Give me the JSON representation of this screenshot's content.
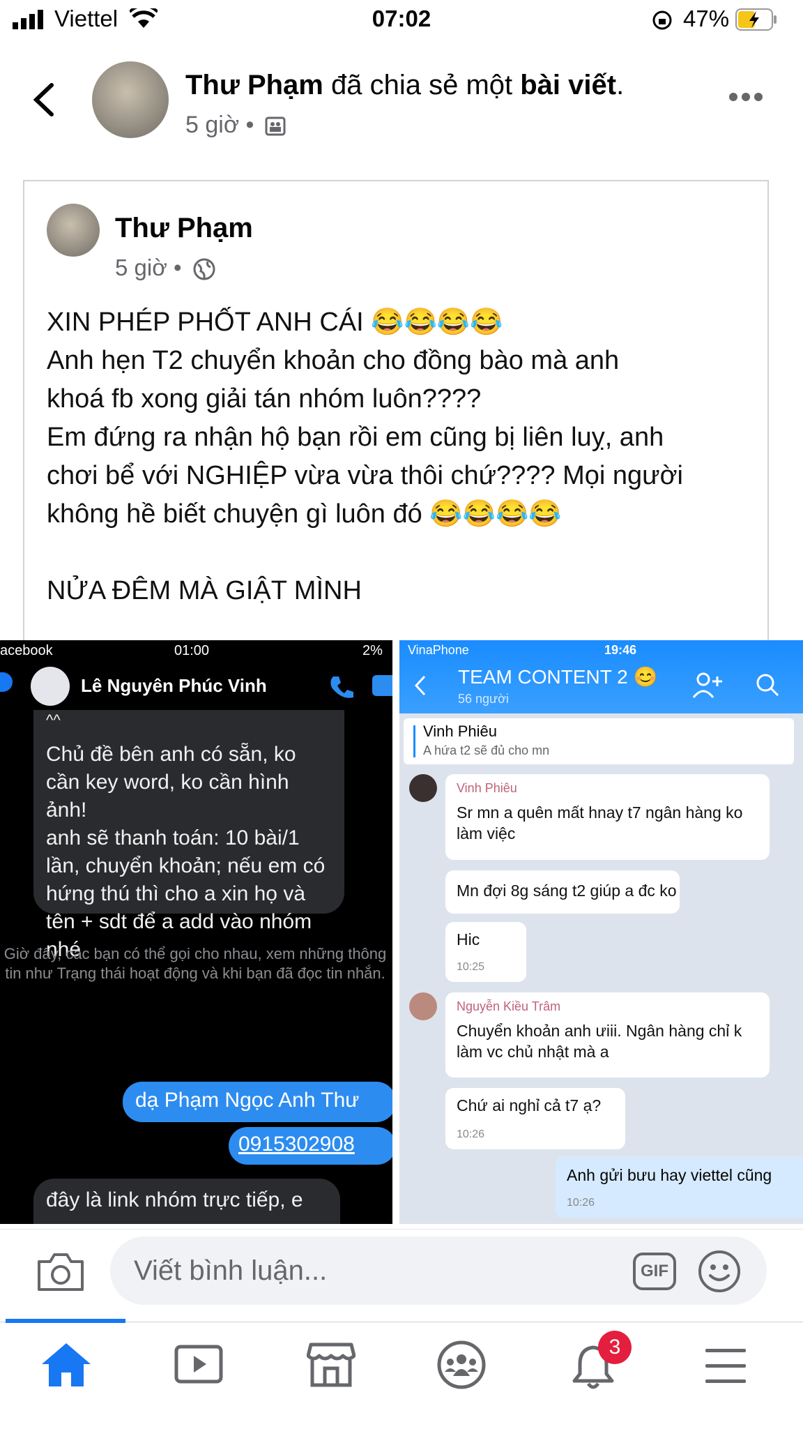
{
  "status_bar": {
    "carrier": "Viettel",
    "time": "07:02",
    "battery": "47%"
  },
  "header": {
    "name": "Thư Phạm",
    "action_mid": " đã chia sẻ một ",
    "action_end": "bài viết",
    "action_dot": ".",
    "meta": "5 giờ •"
  },
  "post": {
    "author": "Thư Phạm",
    "meta": "5 giờ •",
    "text": "XIN PHÉP PHỐT ANH CÁI 😂😂😂😂\nAnh hẹn T2 chuyển khoản cho đồng bào mà anh\nkhoá fb xong giải tán nhóm luôn????\nEm đứng ra nhận hộ bạn rồi em cũng bị liên luỵ, anh\nchơi bể với NGHIỆP vừa vừa thôi chứ???? Mọi người\nkhông hề biết chuyện gì luôn đó 😂😂😂😂\n\nNỬA ĐÊM MÀ GIẬT MÌNH"
  },
  "left_shot": {
    "status_left": "acebook",
    "status_time": "01:00",
    "status_right": "2%",
    "contact_name": "Lê Nguyên Phúc Vinh",
    "msg_top": "^^",
    "msg_main": "Chủ đề bên anh có sẵn, ko cần key word, ko cần hình ảnh!\nanh sẽ thanh toán: 10 bài/1 lần, chuyển khoản; nếu em có hứng thú thì cho a xin họ và tên + sdt để a add vào nhóm nhé",
    "system_note": "Giờ đây, các bạn có thể gọi cho nhau, xem những thông tin như Trạng thái hoạt động và khi bạn đã đọc tin nhắn.",
    "reply_1": "dạ Phạm Ngọc Anh Thư",
    "reply_2": "0915302908",
    "msg_bottom": "đây là link nhóm trực tiếp, e"
  },
  "right_shot": {
    "status_carrier": "VinaPhone",
    "status_time": "19:46",
    "group_name": "TEAM CONTENT 2 😊",
    "group_members": "56 người",
    "pinned_name": "Vinh Phiêu",
    "pinned_text": "A hứa t2 sẽ đủ cho mn",
    "sender_1": "Vinh Phiêu",
    "m1": "Sr mn a quên mất hnay t7 ngân hàng ko làm việc",
    "m2": "Mn đợi 8g sáng t2 giúp a đc ko",
    "m3": "Hic",
    "m3_time": "10:25",
    "sender_2": "Nguyễn Kiều Trâm",
    "m4": "Chuyển khoản anh ưiii. Ngân hàng chỉ k làm vc chủ nhật mà a",
    "m5": "Chứ ai nghỉ cả t7 ạ?",
    "m5_time": "10:26",
    "m6": "Anh gửi bưu hay viettel cũng",
    "m6_time": "10:26"
  },
  "comment_bar": {
    "placeholder": "Viết bình luận...",
    "gif_label": "GIF"
  },
  "nav": {
    "notification_count": "3"
  },
  "colors": {
    "facebook_blue": "#1877f2",
    "badge_red": "#e41e3f",
    "messenger_blue": "#2d8cf0",
    "zalo_blue": "#1a8cff"
  }
}
